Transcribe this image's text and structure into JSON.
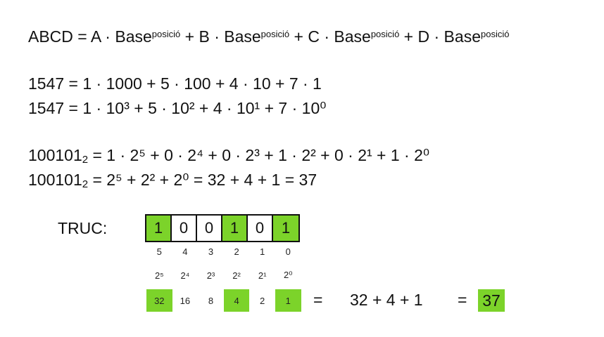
{
  "formulas": {
    "general": {
      "lhs": "ABCD = A · Base",
      "sup1": "posició",
      "mid1": " + B · Base",
      "sup2": "posició",
      "mid2": " + C · Base",
      "sup3": "posició",
      "mid3": " + D · Base",
      "sup4": "posició"
    },
    "decimal_1": "1547 = 1 · 1000 + 5 · 100 + 4 · 10 + 7 · 1",
    "decimal_2": "1547 = 1 · 10³ + 5 · 10² + 4 · 10¹ + 7 · 10⁰",
    "binary_1": {
      "number": "100101",
      "base": "2",
      "rest": " = 1 · 2⁵ + 0 · 2⁴ + 0 · 2³ + 1 · 2² + 0 · 2¹ + 1 · 2⁰"
    },
    "binary_2": {
      "number": "100101",
      "base": "2",
      "rest": " = 2⁵ + 2² + 2⁰ = 32 + 4 + 1 = 37"
    }
  },
  "trick": {
    "label": "TRUC:",
    "bits": [
      "1",
      "0",
      "0",
      "1",
      "0",
      "1"
    ],
    "bit_on": [
      true,
      false,
      false,
      true,
      false,
      true
    ],
    "positions": [
      "5",
      "4",
      "3",
      "2",
      "1",
      "0"
    ],
    "powers": [
      "2⁵",
      "2⁴",
      "2³",
      "2²",
      "2¹",
      "2⁰"
    ],
    "values": [
      "32",
      "16",
      "8",
      "4",
      "2",
      "1"
    ],
    "equals1": "=",
    "sum_expression": "32 + 4 + 1",
    "equals2": "=",
    "result": "37"
  },
  "colors": {
    "highlight": "#7cd32a",
    "text": "#111111",
    "background": "#ffffff"
  }
}
